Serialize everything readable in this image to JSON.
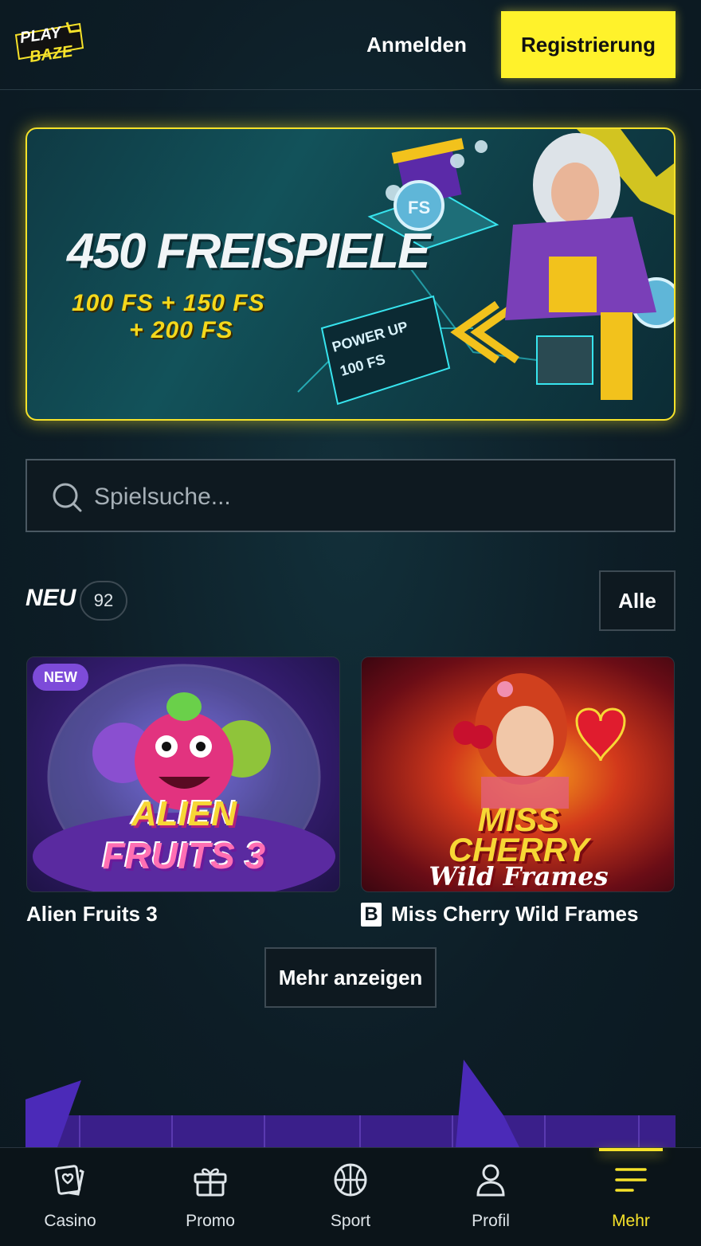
{
  "header": {
    "logo_line1": "PLAY",
    "logo_line2": "BAZE",
    "login_label": "Anmelden",
    "register_label": "Registrierung"
  },
  "banner": {
    "title": "450 FREISPIELE",
    "subtitle_line1": "100 FS + 150 FS",
    "subtitle_line2": "+ 200 FS",
    "art_text_1": "POWER UP",
    "art_text_2": "100 FS",
    "art_coin_label": "FS"
  },
  "search": {
    "placeholder": "Spielsuche..."
  },
  "section": {
    "title": "NEU",
    "count": "92",
    "all_label": "Alle"
  },
  "games": [
    {
      "title": "Alien Fruits 3",
      "badge": "NEW",
      "logo_line1": "ALIEN",
      "logo_line2": "FRUITS 3"
    },
    {
      "title": "Miss Cherry Wild Frames",
      "provider_icon": "B",
      "logo_line1": "MISS",
      "logo_line2": "CHERRY",
      "logo_line3": "Wild Frames"
    }
  ],
  "more_label": "Mehr anzeigen",
  "nav": [
    {
      "label": "Casino",
      "icon": "cards-icon"
    },
    {
      "label": "Promo",
      "icon": "gift-icon"
    },
    {
      "label": "Sport",
      "icon": "basketball-icon"
    },
    {
      "label": "Profil",
      "icon": "user-icon"
    },
    {
      "label": "Mehr",
      "icon": "menu-icon",
      "active": true
    }
  ],
  "colors": {
    "accent": "#f6e22a",
    "background": "#0d1a22",
    "badge": "#7d4bd9"
  }
}
